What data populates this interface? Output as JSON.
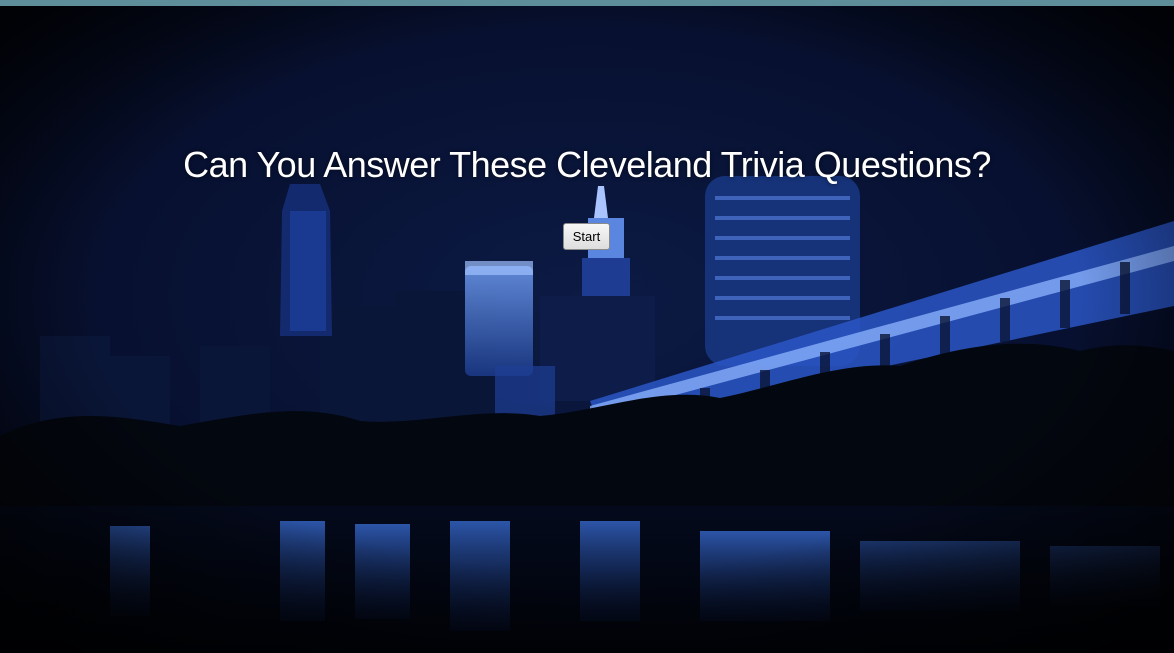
{
  "colors": {
    "accent_strip": "#5e8e9a",
    "title_text": "#ffffff",
    "city_glow": "#3c78ff"
  },
  "background": {
    "icon": "cleveland-night-skyline-image"
  },
  "main": {
    "title": "Can You Answer These Cleveland Trivia Questions?",
    "start_label": "Start"
  }
}
